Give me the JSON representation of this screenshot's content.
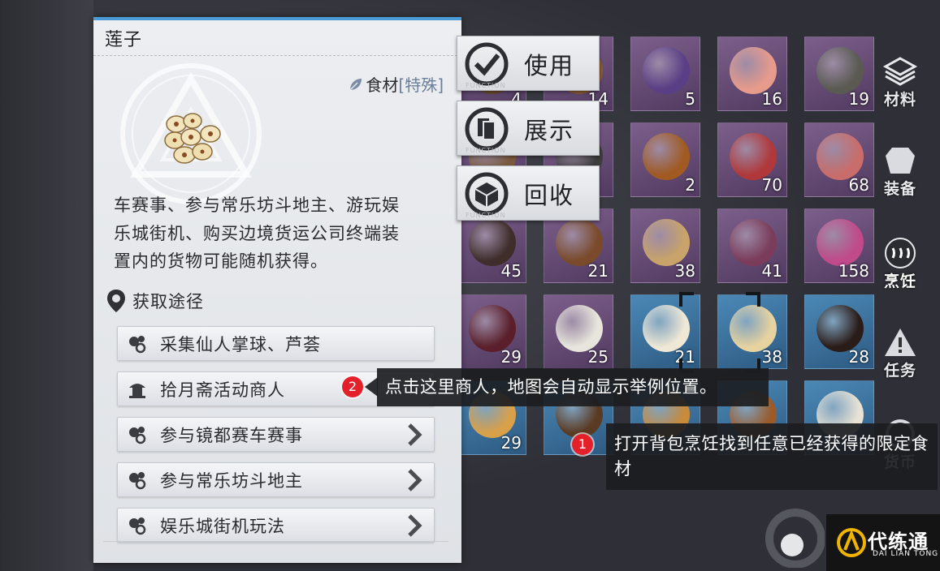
{
  "item": {
    "name": "莲子",
    "category": "食材",
    "tag": "[特殊]",
    "description_lines": [
      "车赛事、参与常乐坊斗地主、游玩娱",
      "乐城街机、购买边境货运公司终端装",
      "置内的货物可能随机获得。"
    ]
  },
  "sources": {
    "header": "获取途径",
    "routes": [
      {
        "label": "采集仙人掌球、芦荟",
        "icon": "plant-icon",
        "arrow": false
      },
      {
        "label": "拾月斋活动商人",
        "icon": "merchant-icon",
        "arrow": false
      },
      {
        "label": "参与镜都赛车赛事",
        "icon": "plant-icon",
        "arrow": true
      },
      {
        "label": "参与常乐坊斗地主",
        "icon": "plant-icon",
        "arrow": true
      },
      {
        "label": "娱乐城街机玩法",
        "icon": "plant-icon",
        "arrow": true
      }
    ]
  },
  "actions": [
    {
      "label": "使用",
      "icon": "check-icon",
      "ghost": "FUNCTION"
    },
    {
      "label": "展示",
      "icon": "cards-icon",
      "ghost": "FUNCTION"
    },
    {
      "label": "回收",
      "icon": "recycle-icon",
      "ghost": "FUNCTION"
    }
  ],
  "inventory": [
    {
      "count": "4",
      "color": "purple",
      "food": "#6b4a2b"
    },
    {
      "count": "14",
      "color": "purple",
      "food": "#8a5b32"
    },
    {
      "count": "5",
      "color": "purple",
      "food": "#5a3f86"
    },
    {
      "count": "16",
      "color": "purple",
      "food": "#e79b8c"
    },
    {
      "count": "19",
      "color": "purple",
      "food": "#5a5a52"
    },
    {
      "count": "",
      "color": "purple",
      "food": "#7a5a3c"
    },
    {
      "count": "",
      "color": "purple",
      "food": "#3d3d3d"
    },
    {
      "count": "2",
      "color": "purple",
      "food": "#a05a22"
    },
    {
      "count": "70",
      "color": "purple",
      "food": "#b0383a"
    },
    {
      "count": "68",
      "color": "purple",
      "food": "#c96d6a"
    },
    {
      "count": "45",
      "color": "purple",
      "food": "#3e2d2a"
    },
    {
      "count": "21",
      "color": "purple",
      "food": "#7a4a2a"
    },
    {
      "count": "38",
      "color": "purple",
      "food": "#c9a46a"
    },
    {
      "count": "41",
      "color": "purple",
      "food": "#7a3c5a"
    },
    {
      "count": "158",
      "color": "purple",
      "food": "#c04a8a"
    },
    {
      "count": "29",
      "color": "purple",
      "food": "#5a1f2a"
    },
    {
      "count": "25",
      "color": "purple",
      "food": "#e8e6dc"
    },
    {
      "count": "21",
      "color": "blue",
      "food": "#efe8d6"
    },
    {
      "count": "38",
      "color": "blue",
      "food": "#e7d3a0"
    },
    {
      "count": "28",
      "color": "blue",
      "food": "#2a1c18"
    },
    {
      "count": "29",
      "color": "blue",
      "food": "#d9a04a"
    },
    {
      "count": "",
      "color": "blue",
      "food": "#5a3a22"
    },
    {
      "count": "",
      "color": "blue",
      "food": "#c98a3a"
    },
    {
      "count": "",
      "color": "blue",
      "food": "#9a5a2a"
    },
    {
      "count": "",
      "color": "blue",
      "food": "#e7e2d4"
    }
  ],
  "side_tabs": [
    {
      "label": "材料",
      "icon": "layers-icon"
    },
    {
      "label": "装备",
      "icon": "armor-icon"
    },
    {
      "label": "烹饪",
      "icon": "steam-icon"
    },
    {
      "label": "任务",
      "icon": "alert-icon"
    },
    {
      "label": "货币",
      "icon": "coin-icon"
    }
  ],
  "callouts": {
    "step1": {
      "number": "1",
      "text": "打开背包烹饪找到任意已经获得的限定食材"
    },
    "step2": {
      "number": "2",
      "text": "点击这里商人，地图会自动显示举例位置。"
    }
  },
  "watermark": {
    "name": "代练通",
    "sub": "DAI LIAN TONG"
  },
  "colors": {
    "accent": "#4a9bd6",
    "badge": "#e4212a",
    "purple_slot": "#6a4e7a",
    "blue_slot": "#3c729e"
  }
}
